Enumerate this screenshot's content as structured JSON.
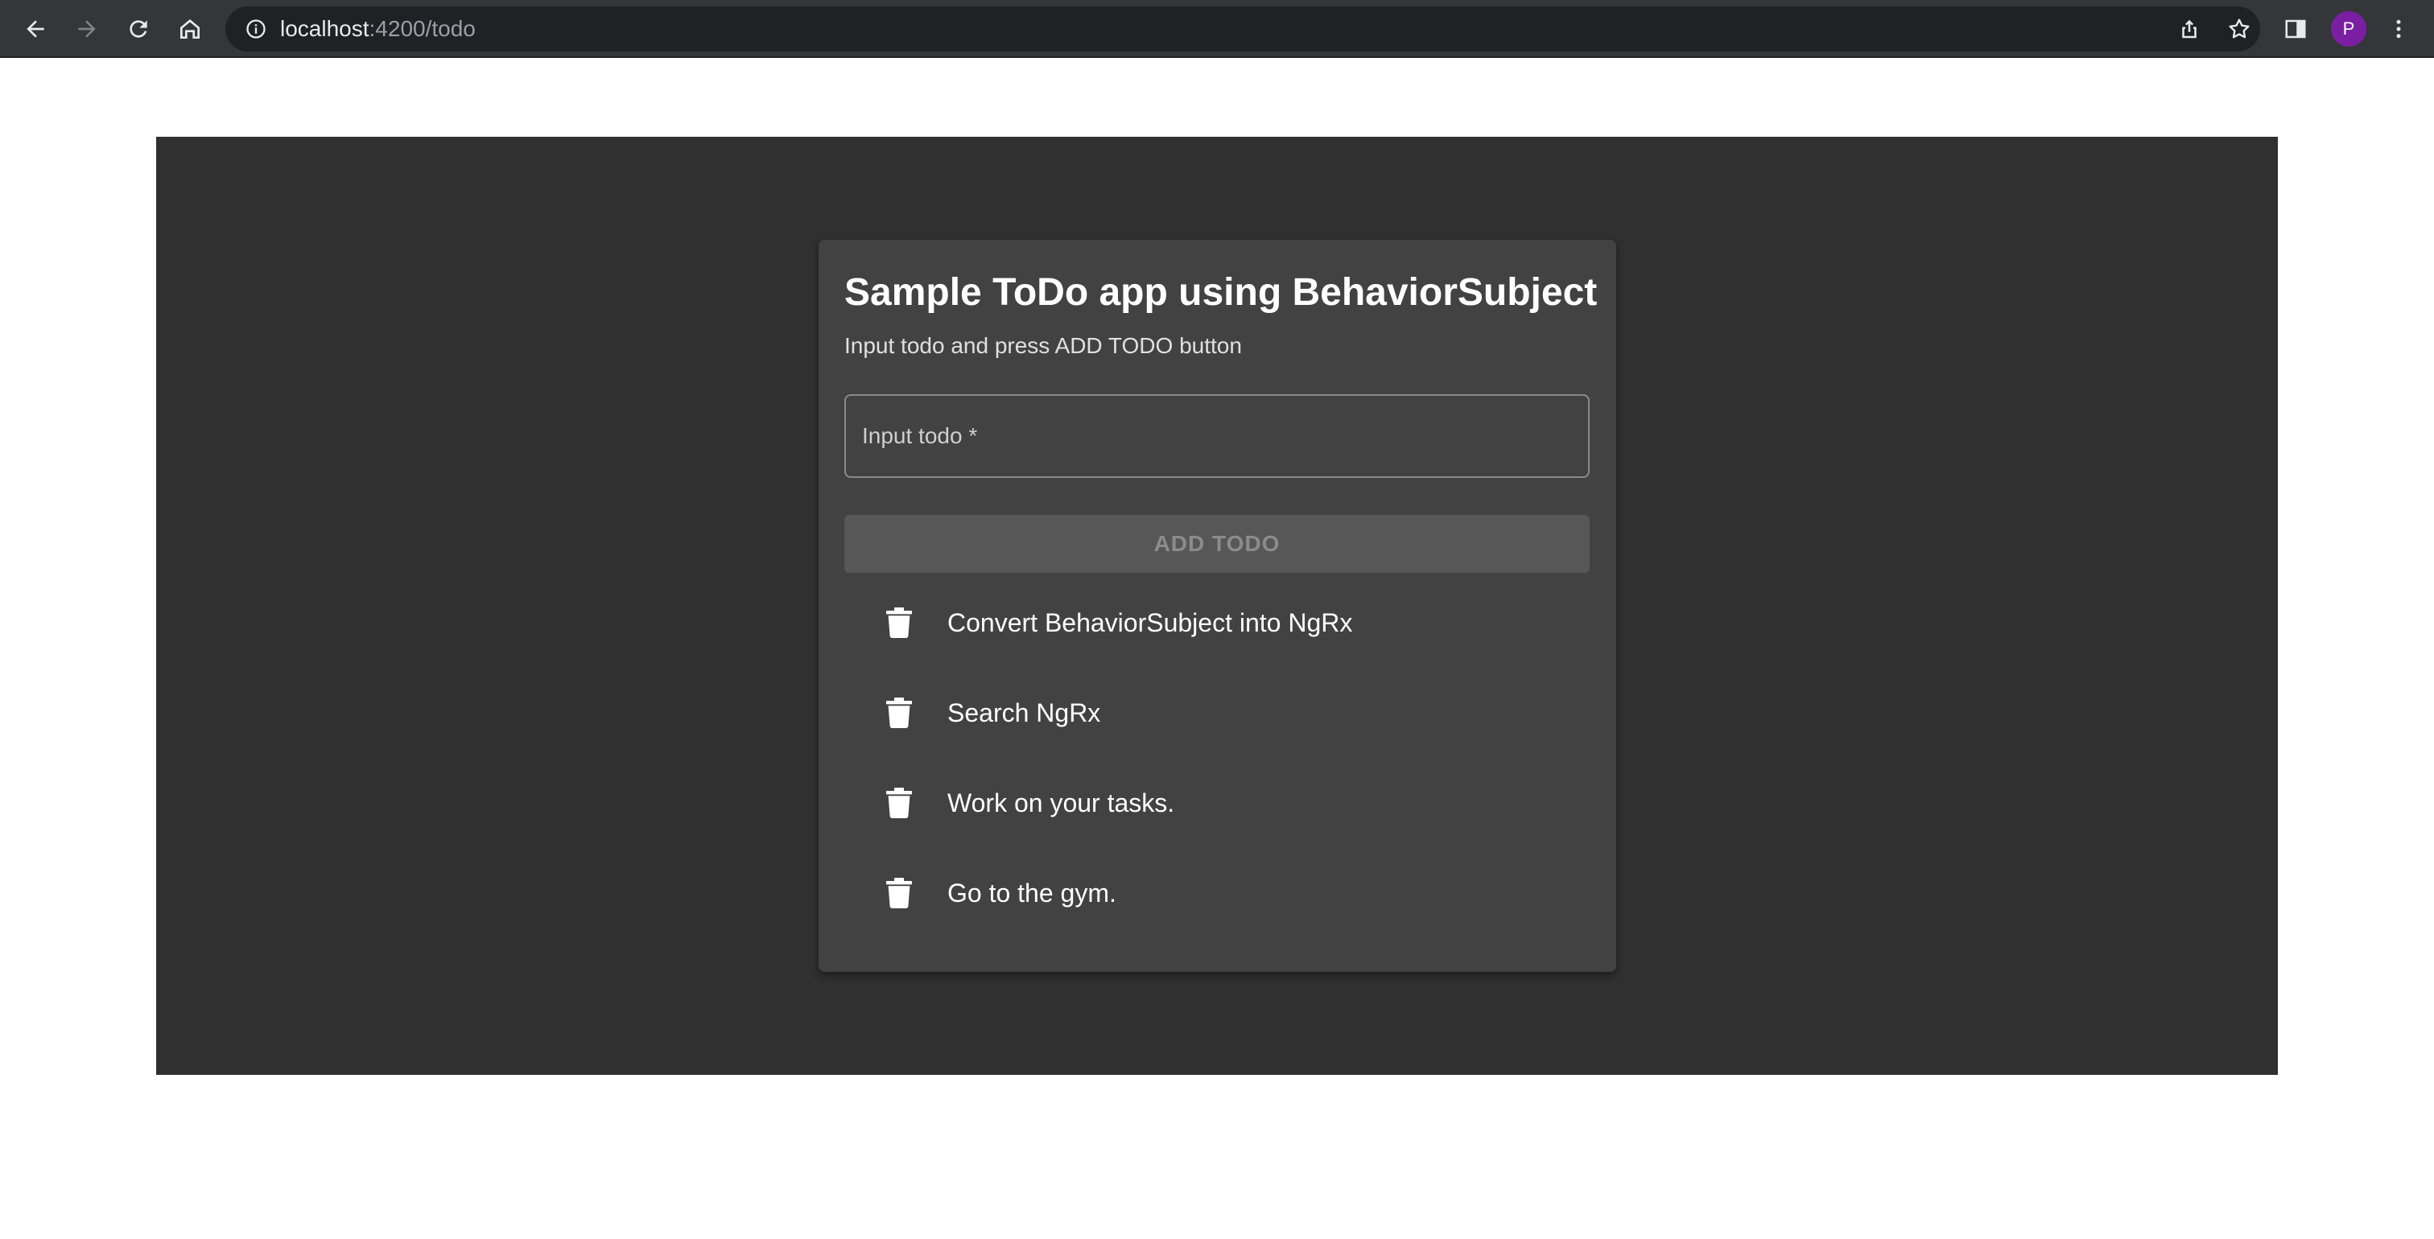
{
  "browser": {
    "url_host": "localhost",
    "url_rest": ":4200/todo",
    "profile_initial": "P"
  },
  "card": {
    "title": "Sample ToDo app using BehaviorSubject",
    "subtitle": "Input todo and press ADD TODO button",
    "input_label": "Input todo *",
    "input_value": "",
    "add_button_label": "ADD TODO"
  },
  "todos": [
    {
      "text": "Convert BehaviorSubject into NgRx"
    },
    {
      "text": "Search NgRx"
    },
    {
      "text": "Work on your tasks."
    },
    {
      "text": "Go to the gym."
    }
  ],
  "icons": {
    "back": "back-arrow-icon",
    "forward": "forward-arrow-icon",
    "reload": "reload-icon",
    "home": "home-icon",
    "info": "info-icon",
    "share": "share-icon",
    "bookmark": "star-icon",
    "side_panel": "side-panel-icon",
    "menu": "kebab-menu-icon",
    "delete": "trash-icon"
  },
  "colors": {
    "toolbar": "#35363a",
    "omnibox": "#202124",
    "app_background": "#303030",
    "card": "#424242",
    "avatar": "#7b1fa2",
    "button_disabled": "#575757"
  }
}
